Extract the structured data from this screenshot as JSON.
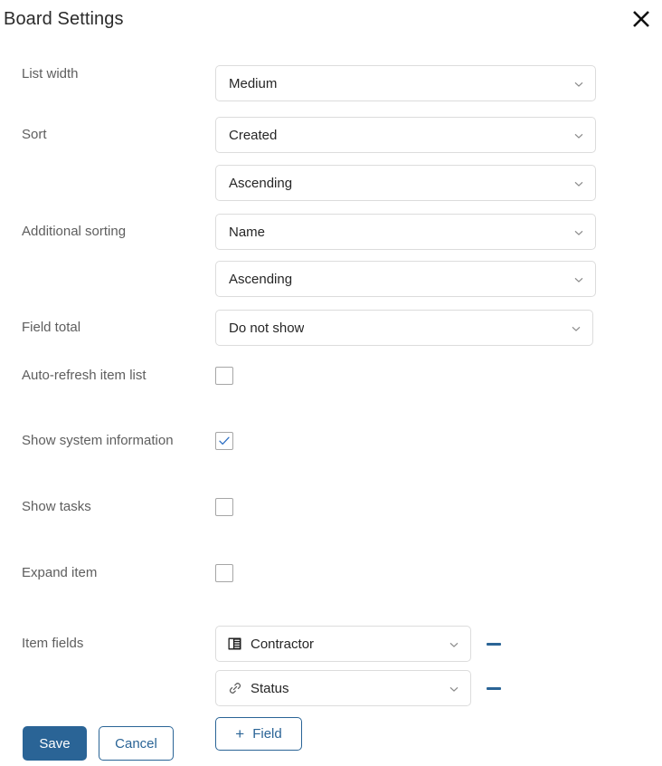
{
  "dialog": {
    "title": "Board Settings",
    "close_icon": "close-x-icon"
  },
  "fields": {
    "list_width": {
      "label": "List width",
      "value": "Medium",
      "caret_icon": "chevron-down-icon"
    },
    "sort": {
      "label": "Sort",
      "field_value": "Created",
      "direction_value": "Ascending"
    },
    "additional_sorting": {
      "label": "Additional sorting",
      "field_value": "Name",
      "direction_value": "Ascending"
    },
    "field_total": {
      "label": "Field total",
      "value": "Do not show"
    },
    "auto_refresh": {
      "label": "Auto-refresh item list",
      "checked": false
    },
    "show_system_information": {
      "label": "Show system information",
      "checked": true
    },
    "show_tasks": {
      "label": "Show tasks",
      "checked": false
    },
    "expand_item": {
      "label": "Expand item",
      "checked": false
    },
    "item_fields": {
      "label": "Item fields",
      "rows": [
        {
          "value": "Contractor",
          "icon": "record-card-icon",
          "remove_icon": "minus-icon"
        },
        {
          "value": "Status",
          "icon": "link-chain-icon",
          "remove_icon": "minus-icon"
        }
      ],
      "add_button": {
        "label": "Field",
        "plus": "+"
      }
    }
  },
  "footer": {
    "save_label": "Save",
    "cancel_label": "Cancel"
  },
  "colors": {
    "accent_blue": "#2a6496",
    "label_gray": "#5e5e5e",
    "border_gray": "#dcdcdc",
    "checkbox_border": "#a6a6a6",
    "text": "#262626"
  }
}
